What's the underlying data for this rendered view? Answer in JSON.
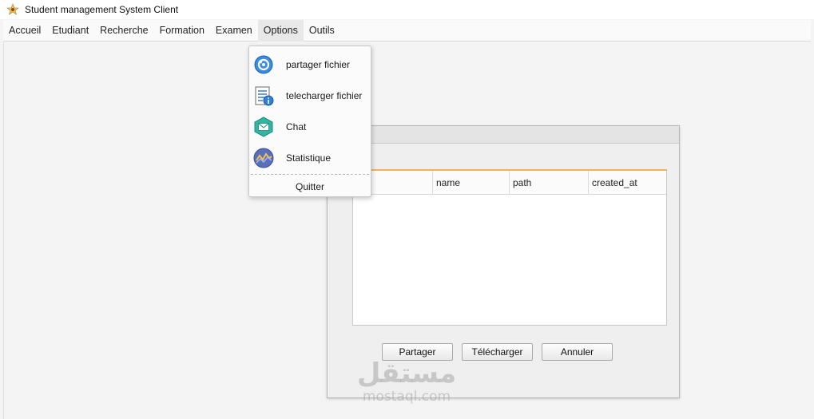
{
  "window": {
    "title": "Student management System Client"
  },
  "menubar": {
    "items": [
      {
        "label": "Accueil"
      },
      {
        "label": "Etudiant"
      },
      {
        "label": "Recherche"
      },
      {
        "label": "Formation"
      },
      {
        "label": "Examen"
      },
      {
        "label": "Options",
        "active": true
      },
      {
        "label": "Outils"
      }
    ]
  },
  "options_menu": {
    "items": [
      {
        "label": "partager fichier",
        "icon": "share-refresh-icon"
      },
      {
        "label": "telecharger fichier",
        "icon": "document-info-icon"
      },
      {
        "label": "Chat",
        "icon": "envelope-icon"
      },
      {
        "label": "Statistique",
        "icon": "chart-wave-icon"
      }
    ],
    "quit_label": "Quitter"
  },
  "files_dialog": {
    "table": {
      "columns": [
        "",
        "name",
        "path",
        "created_at"
      ],
      "rows": []
    },
    "buttons": {
      "share": "Partager",
      "download": "Télécharger",
      "cancel": "Annuler"
    }
  },
  "watermark": {
    "arabic": "مستقل",
    "latin": "mostaql.com"
  },
  "colors": {
    "accent_border": "#f0b25a",
    "menu_active_bg": "#e8e8e8",
    "window_bg": "#f4f4f4"
  }
}
